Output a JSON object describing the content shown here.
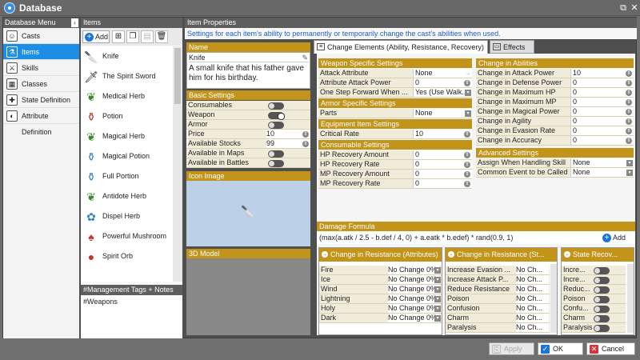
{
  "window": {
    "title": "Database",
    "icons": [
      "app-icon",
      "close-icon"
    ]
  },
  "menu": {
    "header": "Database Menu",
    "items": [
      {
        "label": "Casts",
        "icon": "casts-icon"
      },
      {
        "label": "Items",
        "icon": "items-icon",
        "selected": true
      },
      {
        "label": "Skills",
        "icon": "skills-icon"
      },
      {
        "label": "Classes",
        "icon": "classes-icon"
      },
      {
        "label": "State Definition",
        "icon": "state-icon"
      },
      {
        "label": "Attribute Definition",
        "icon": "attribute-icon"
      }
    ]
  },
  "items": {
    "header": "Items",
    "add_label": "Add",
    "list": [
      {
        "label": "Knife",
        "icon": "knife-icon"
      },
      {
        "label": "The Spirit Sword",
        "icon": "sword-icon"
      },
      {
        "label": "Medical Herb",
        "icon": "herb-icon"
      },
      {
        "label": "Potion",
        "icon": "potion-icon"
      },
      {
        "label": "Magical Herb",
        "icon": "herb-icon"
      },
      {
        "label": "Magical Potion",
        "icon": "potion-icon"
      },
      {
        "label": "Full Portion",
        "icon": "potion-icon"
      },
      {
        "label": "Antidote Herb",
        "icon": "herb-icon"
      },
      {
        "label": "Dispel Herb",
        "icon": "herb-icon"
      },
      {
        "label": "Powerful Mushroom",
        "icon": "mushroom-icon"
      },
      {
        "label": "Spirit Orb",
        "icon": "orb-icon"
      }
    ],
    "tags_header": "#Management Tags + Notes",
    "tags_value": "#Weapons"
  },
  "props": {
    "header": "Item Properties",
    "description": "Settings for each item's ability to permanently or temporarily change the cast's abilities when used.",
    "name_header": "Name",
    "name_value": "Knife",
    "name_desc": "A small knife that his father gave him for his birthday.",
    "basic_header": "Basic Settings",
    "basic": [
      {
        "label": "Consumables",
        "type": "toggle",
        "on": false
      },
      {
        "label": "Weapon",
        "type": "toggle",
        "on": true
      },
      {
        "label": "Armor",
        "type": "toggle",
        "on": false
      },
      {
        "label": "Price",
        "type": "number",
        "value": "10"
      },
      {
        "label": "Available Stocks",
        "type": "number",
        "value": "99"
      },
      {
        "label": "Available in Maps",
        "type": "toggle",
        "on": false
      },
      {
        "label": "Available in Battles",
        "type": "toggle",
        "on": false
      }
    ],
    "icon_header": "Icon Image",
    "model_header": "3D Model"
  },
  "tabs": [
    {
      "label": "Change Elements (Ability, Resistance, Recovery)",
      "active": true
    },
    {
      "label": "Effects",
      "active": false
    }
  ],
  "weapon": {
    "header": "Weapon Specific Settings",
    "rows": [
      {
        "label": "Attack Attribute",
        "value": "None"
      },
      {
        "label": "Attribute Attack Power",
        "value": "0"
      },
      {
        "label": "One Step Forward When ...",
        "value": "Yes (Use Walk..."
      }
    ]
  },
  "armor": {
    "header": "Armor Specific Settings",
    "rows": [
      {
        "label": "Parts",
        "value": "None"
      }
    ]
  },
  "equip": {
    "header": "Equipment Item Settings",
    "rows": [
      {
        "label": "Critical Rate",
        "value": "10"
      }
    ]
  },
  "consumable": {
    "header": "Consumable Settings",
    "rows": [
      {
        "label": "HP Recovery Amount",
        "value": "0"
      },
      {
        "label": "HP Recovery Rate",
        "value": "0"
      },
      {
        "label": "MP Recovery Amount",
        "value": "0"
      },
      {
        "label": "MP Recovery Rate",
        "value": "0"
      }
    ]
  },
  "abilities": {
    "header": "Change in Abilities",
    "rows": [
      {
        "label": "Change in Attack Power",
        "value": "10"
      },
      {
        "label": "Change in Defense Power",
        "value": "0"
      },
      {
        "label": "Change in Maximum HP",
        "value": "0"
      },
      {
        "label": "Change in Maximum MP",
        "value": "0"
      },
      {
        "label": "Change in Magical Power",
        "value": "0"
      },
      {
        "label": "Change in Agility",
        "value": "0"
      },
      {
        "label": "Change in Evasion Rate",
        "value": "0"
      },
      {
        "label": "Change in Accuracy",
        "value": "0"
      }
    ]
  },
  "advanced": {
    "header": "Advanced Settings",
    "rows": [
      {
        "label": "Assign When Handling Skill",
        "value": "None"
      },
      {
        "label": "Common Event to be Called",
        "value": "None"
      }
    ]
  },
  "formula": {
    "header": "Damage Formula",
    "value": "(max(a.atk / 2.5 - b.def / 4, 0) + a.eatk * b.edef) * rand(0.9, 1)",
    "add_label": "Add"
  },
  "res_attr": {
    "header": "Change in Resistance (Attributes)",
    "rows": [
      {
        "label": "Fire",
        "value": "No Change 0%"
      },
      {
        "label": "Ice",
        "value": "No Change 0%"
      },
      {
        "label": "Wind",
        "value": "No Change 0%"
      },
      {
        "label": "Lightning",
        "value": "No Change 0%"
      },
      {
        "label": "Holy",
        "value": "No Change 0%"
      },
      {
        "label": "Dark",
        "value": "No Change 0%"
      }
    ]
  },
  "res_state": {
    "header": "Change in Resistance (St...",
    "rows": [
      {
        "label": "Increase Evasion ...",
        "value": "No Ch..."
      },
      {
        "label": "Increase Attack P...",
        "value": "No Ch..."
      },
      {
        "label": "Reduce Resistance",
        "value": "No Ch..."
      },
      {
        "label": "Poison",
        "value": "No Ch..."
      },
      {
        "label": "Confusion",
        "value": "No Ch..."
      },
      {
        "label": "Charm",
        "value": "No Ch..."
      },
      {
        "label": "Paralysis",
        "value": "No Ch..."
      }
    ]
  },
  "state_recov": {
    "header": "State Recov...",
    "rows": [
      {
        "label": "Incre..."
      },
      {
        "label": "Incre..."
      },
      {
        "label": "Reduc..."
      },
      {
        "label": "Poison"
      },
      {
        "label": "Confu..."
      },
      {
        "label": "Charm"
      },
      {
        "label": "Paralysis"
      }
    ]
  },
  "buttons": {
    "apply": "Apply",
    "ok": "OK",
    "cancel": "Cancel"
  }
}
